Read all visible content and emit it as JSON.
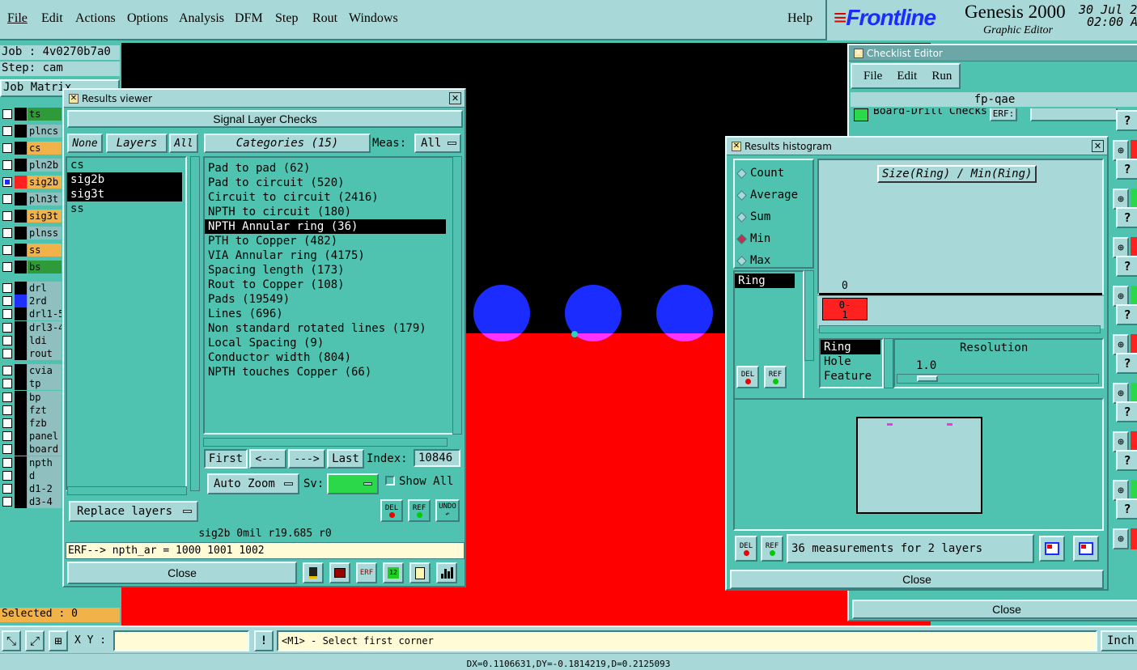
{
  "menubar": {
    "items": [
      "File",
      "Edit",
      "Actions",
      "Options",
      "Analysis",
      "DFM",
      "Step",
      "Rout",
      "Windows"
    ],
    "help": "Help"
  },
  "brand": {
    "logo": "Frontline",
    "product": "Genesis 2000",
    "subtitle": "Graphic Editor",
    "date": "30 Jul 2",
    "time": "02:00 A"
  },
  "job": {
    "job": "Job : 4v0270b7a0",
    "step": "Step: cam",
    "matrix": "Job Matrix",
    "selected": "Selected : 0"
  },
  "layers": [
    {
      "name": "ts",
      "color": "#2f9a3a"
    },
    {
      "name": "plncs",
      "color": "#8fc0bf"
    },
    {
      "name": "cs",
      "color": "#f2b24a"
    },
    {
      "name": "pln2b",
      "color": "#8fc0bf"
    },
    {
      "name": "sig2b",
      "color": "#f2b24a",
      "swatch": "#ff2020",
      "active": true
    },
    {
      "name": "pln3t",
      "color": "#8fc0bf"
    },
    {
      "name": "sig3t",
      "color": "#f2b24a"
    },
    {
      "name": "plnss",
      "color": "#8fc0bf"
    },
    {
      "name": "ss",
      "color": "#f2b24a"
    },
    {
      "name": "bs",
      "color": "#2f9a3a"
    },
    {
      "name": "drl",
      "color": "#8fc0bf"
    },
    {
      "name": "2rd",
      "color": "#8fc0bf",
      "swatch": "#2030ff"
    },
    {
      "name": "drl1-5",
      "color": "#8fc0bf"
    },
    {
      "name": "drl3-4",
      "color": "#8fc0bf"
    },
    {
      "name": "ldi",
      "color": "#8fc0bf"
    },
    {
      "name": "rout",
      "color": "#8fc0bf"
    },
    {
      "name": "cvia",
      "color": "#8fc0bf"
    },
    {
      "name": "tp",
      "color": "#8fc0bf"
    },
    {
      "name": "bp",
      "color": "#8fc0bf"
    },
    {
      "name": "fzt",
      "color": "#8fc0bf"
    },
    {
      "name": "fzb",
      "color": "#8fc0bf"
    },
    {
      "name": "panel",
      "color": "#8fc0bf"
    },
    {
      "name": "board",
      "color": "#8fc0bf"
    },
    {
      "name": "npth",
      "color": "#8fc0bf"
    },
    {
      "name": "d",
      "color": "#8fc0bf"
    },
    {
      "name": "d1-2",
      "color": "#8fc0bf"
    },
    {
      "name": "d3-4",
      "color": "#8fc0bf"
    }
  ],
  "results": {
    "title": "Results viewer",
    "header": "Signal Layer Checks",
    "none": "None",
    "layers_label": "Layers",
    "all": "All",
    "categories_label": "Categories (15)",
    "meas_label": "Meas:",
    "meas_value": "All",
    "layer_list": [
      {
        "t": "cs"
      },
      {
        "t": "sig2b",
        "sel": true
      },
      {
        "t": "sig3t",
        "sel": true
      },
      {
        "t": "ss"
      }
    ],
    "categories": [
      {
        "t": "Pad to pad (62)"
      },
      {
        "t": "Pad to circuit (520)"
      },
      {
        "t": "Circuit to circuit (2416)"
      },
      {
        "t": "NPTH to circuit (180)"
      },
      {
        "t": "NPTH Annular ring (36)",
        "sel": true
      },
      {
        "t": "PTH to Copper (482)"
      },
      {
        "t": "VIA Annular ring (4175)"
      },
      {
        "t": "Spacing length (173)"
      },
      {
        "t": "Rout to Copper (108)"
      },
      {
        "t": "Pads (19549)"
      },
      {
        "t": "Lines (696)"
      },
      {
        "t": "Non standard rotated lines (179)"
      },
      {
        "t": "Local Spacing (9)"
      },
      {
        "t": "Conductor width (804)"
      },
      {
        "t": "NPTH touches Copper (66)"
      }
    ],
    "first": "First",
    "prev": "<---",
    "next": "--->",
    "last": "Last",
    "index_label": "Index:",
    "index_value": "10846",
    "auto_zoom": "Auto Zoom",
    "sv_label": "Sv:",
    "show_all": "Show All",
    "replace_layers": "Replace layers",
    "del": "DEL",
    "ref": "REF",
    "undo": "UNDO",
    "info": "sig2b 0mil  r19.685  r0",
    "erf": "ERF--> npth_ar = 1000 1001 1002",
    "close": "Close"
  },
  "checklist": {
    "title": "Checklist Editor",
    "menu": [
      "File",
      "Edit",
      "Run"
    ],
    "name": "fp-qae",
    "row": "Board-Drill Checks",
    "erf": "ERF:",
    "close": "Close"
  },
  "histogram": {
    "title": "Results histogram",
    "modes": [
      "Count",
      "Average",
      "Sum",
      "Min",
      "Max"
    ],
    "selected_mode": "Min",
    "graph_title": "Size(Ring) / Min(Ring)",
    "zero_label": "0",
    "bin_label": "0-\n1",
    "list": [
      "Ring"
    ],
    "types": [
      "Ring",
      "Hole",
      "Feature"
    ],
    "resolution_label": "Resolution",
    "resolution_value": "1.0",
    "summary": "36 measurements for 2 layers",
    "close": "Close",
    "del": "DEL",
    "ref": "REF"
  },
  "bottom": {
    "xy_label": "X Y :",
    "xy_value": "",
    "hint": "<M1> - Select first corner",
    "units": "Inch",
    "coords": "DX=0.1106631,DY=-0.1814219,D=0.2125093"
  },
  "colors": {
    "panel": "#4fc3b0",
    "light": "#a8d9d8",
    "pad": "#1a2cff",
    "copper": "#ff0000",
    "pad_overlap": "#ff33ff"
  }
}
